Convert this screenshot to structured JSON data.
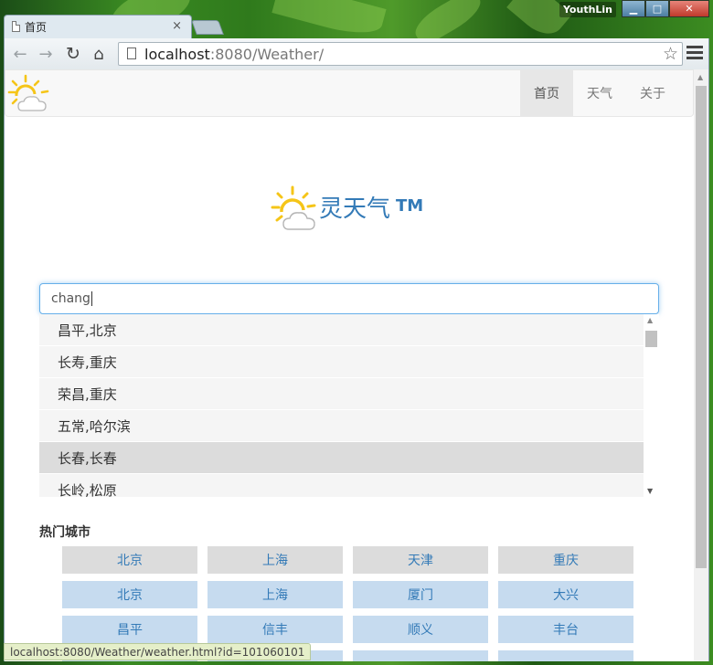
{
  "window": {
    "tab_title": "首页",
    "tab_close": "×",
    "user_name": "YouthLin",
    "controls": {
      "minimize": "▁",
      "maximize": "□",
      "close": "✕"
    }
  },
  "toolbar": {
    "back_icon": "←",
    "forward_icon": "→",
    "reload_icon": "↻",
    "home_icon": "⌂",
    "url_host": "localhost",
    "url_path": ":8080/Weather/",
    "star_icon": "☆"
  },
  "navbar": {
    "items": [
      {
        "label": "首页",
        "active": true
      },
      {
        "label": "天气",
        "active": false
      },
      {
        "label": "关于",
        "active": false
      }
    ]
  },
  "hero": {
    "title": "灵天气",
    "trademark": "TM"
  },
  "search": {
    "value": "chang",
    "suggestions": [
      {
        "label": "昌平,北京",
        "highlighted": false
      },
      {
        "label": "长寿,重庆",
        "highlighted": false
      },
      {
        "label": "荣昌,重庆",
        "highlighted": false
      },
      {
        "label": "五常,哈尔滨",
        "highlighted": false
      },
      {
        "label": "长春,长春",
        "highlighted": true
      },
      {
        "label": "长岭,松原",
        "highlighted": false
      }
    ]
  },
  "hot_cities": {
    "title": "热门城市",
    "rows": [
      [
        "北京",
        "上海",
        "天津",
        "重庆"
      ],
      [
        "北京",
        "上海",
        "厦门",
        "大兴"
      ],
      [
        "昌平",
        "信丰",
        "顺义",
        "丰台"
      ]
    ]
  },
  "status_bar": {
    "text": "localhost:8080/Weather/weather.html?id=101060101"
  },
  "colors": {
    "link": "#337ab7",
    "hot_gray": "#dcdcdc",
    "hot_blue": "#c6dbef",
    "sun": "#f5c518"
  }
}
